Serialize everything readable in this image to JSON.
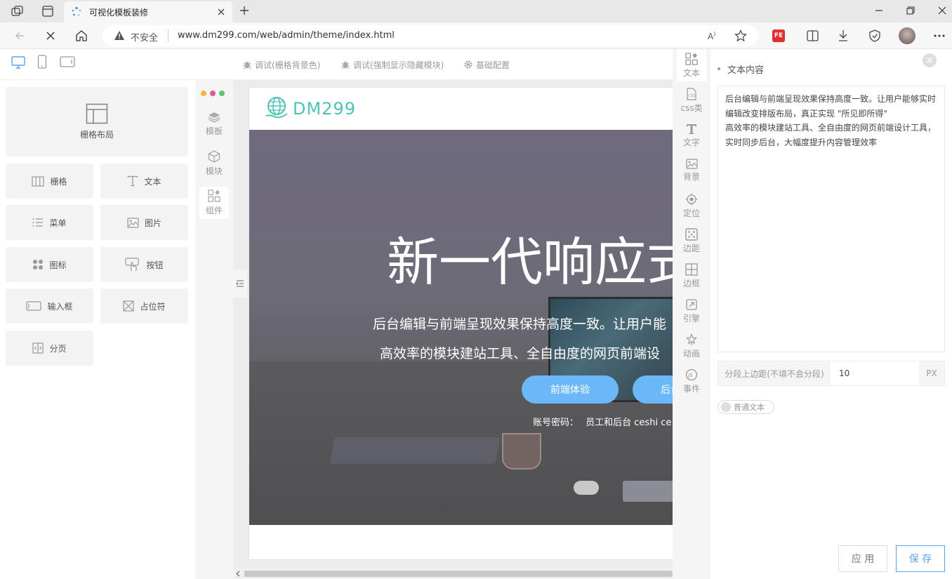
{
  "browser": {
    "tab_title": "可视化模板装修",
    "url_warning": "不安全",
    "url": "www.dm299.com/web/admin/theme/index.html"
  },
  "topbar": {
    "debug_grid_bg": "调试(栅格背景色)",
    "debug_hidden": "调试(强制显示隐藏模块)",
    "base_config": "基础配置"
  },
  "left_panel": {
    "grid_layout": "栅格布局",
    "items": [
      {
        "label": "栅格",
        "icon": "columns-icon"
      },
      {
        "label": "文本",
        "icon": "text-icon"
      },
      {
        "label": "菜单",
        "icon": "list-icon"
      },
      {
        "label": "图片",
        "icon": "image-icon"
      },
      {
        "label": "图标",
        "icon": "icons-grid-icon"
      },
      {
        "label": "按钮",
        "icon": "touch-button-icon"
      },
      {
        "label": "输入框",
        "icon": "input-icon"
      },
      {
        "label": "占位符",
        "icon": "placeholder-icon"
      },
      {
        "label": "分页",
        "icon": "pagination-icon"
      }
    ]
  },
  "mid_nav": {
    "template": "模板",
    "module": "模块",
    "component": "组件"
  },
  "preview": {
    "logo_text": "DM299",
    "hero_title": "新一代响应式",
    "hero_line1": "后台编辑与前端呈现效果保持高度一致。让用户能",
    "hero_line2": "高效率的模块建站工具、全自由度的网页前端设",
    "btn_front": "前端体验",
    "btn_back": "后台",
    "account_label": "账号密码：",
    "account_value": "员工和后台 ceshi ce"
  },
  "tools": [
    {
      "label": "文本",
      "icon": "text-widget-icon"
    },
    {
      "label": "css类",
      "icon": "css-icon"
    },
    {
      "label": "文字",
      "icon": "font-icon"
    },
    {
      "label": "背景",
      "icon": "background-icon"
    },
    {
      "label": "定位",
      "icon": "position-icon"
    },
    {
      "label": "边距",
      "icon": "margin-icon"
    },
    {
      "label": "边框",
      "icon": "border-icon"
    },
    {
      "label": "引擎",
      "icon": "engine-icon"
    },
    {
      "label": "动画",
      "icon": "animation-icon"
    },
    {
      "label": "事件",
      "icon": "event-icon"
    }
  ],
  "right_panel": {
    "title": "文本内容",
    "text_content": "后台编辑与前端呈现效果保持高度一致。让用户能够实时编辑改变排版布局，真正实现 \"所见即所得\"\n高效率的模块建站工具、全自由度的网页前端设计工具，实时同步后台，大幅度提升内容管理效率",
    "margin_label": "分段上边距(不填不会分段)",
    "margin_value": "10",
    "margin_unit": "PX",
    "toggle_label": "普通文本",
    "apply": "应 用",
    "save": "保 存"
  },
  "colors": {
    "accent": "#5aa3f0",
    "button_blue": "#6ab8f7",
    "logo_teal": "#4ec2b6"
  }
}
